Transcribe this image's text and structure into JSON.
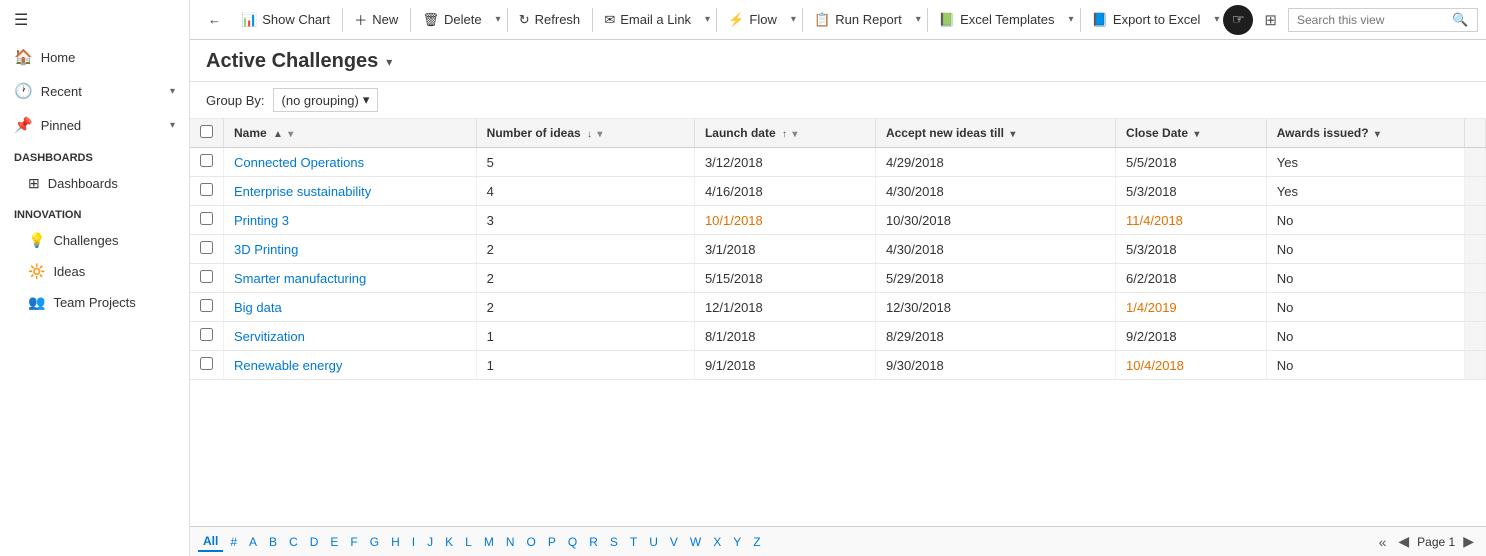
{
  "sidebar": {
    "hamburger": "☰",
    "nav": [
      {
        "id": "home",
        "icon": "🏠",
        "label": "Home",
        "hasChevron": false
      },
      {
        "id": "recent",
        "icon": "🕐",
        "label": "Recent",
        "hasChevron": true
      },
      {
        "id": "pinned",
        "icon": "📌",
        "label": "Pinned",
        "hasChevron": true
      }
    ],
    "sections": [
      {
        "label": "Dashboards",
        "children": [
          {
            "id": "dashboards",
            "icon": "⊞",
            "label": "Dashboards"
          }
        ]
      },
      {
        "label": "Innovation",
        "children": [
          {
            "id": "challenges",
            "icon": "💡",
            "label": "Challenges"
          },
          {
            "id": "ideas",
            "icon": "🔆",
            "label": "Ideas"
          },
          {
            "id": "team-projects",
            "icon": "👥",
            "label": "Team Projects"
          }
        ]
      }
    ]
  },
  "toolbar": {
    "back_icon": "←",
    "show_chart_label": "Show Chart",
    "new_label": "New",
    "delete_label": "Delete",
    "refresh_label": "Refresh",
    "email_link_label": "Email a Link",
    "flow_label": "Flow",
    "run_report_label": "Run Report",
    "excel_templates_label": "Excel Templates",
    "export_excel_label": "Export to Excel",
    "more_icon": "⋯",
    "search_placeholder": "Search this view",
    "search_icon": "🔍"
  },
  "view": {
    "title": "Active Challenges",
    "chevron": "▾",
    "group_by_label": "Group By:",
    "group_by_value": "(no grouping)",
    "group_by_chevron": "▾"
  },
  "columns": [
    {
      "id": "name",
      "label": "Name",
      "sort": "▲",
      "filter": "▾"
    },
    {
      "id": "ideas",
      "label": "Number of ideas",
      "sort": "↓",
      "filter": "▾"
    },
    {
      "id": "launch",
      "label": "Launch date",
      "sort": "↑",
      "filter": "▾"
    },
    {
      "id": "accept",
      "label": "Accept new ideas till",
      "sort": "▾",
      "filter": ""
    },
    {
      "id": "close",
      "label": "Close Date",
      "sort": "▾",
      "filter": ""
    },
    {
      "id": "awards",
      "label": "Awards issued?",
      "sort": "▾",
      "filter": ""
    }
  ],
  "rows": [
    {
      "name": "Connected Operations",
      "ideas": "5",
      "launch": "3/12/2018",
      "accept": "4/29/2018",
      "close": "5/5/2018",
      "awards": "Yes",
      "launchOrange": false,
      "closeOrange": false
    },
    {
      "name": "Enterprise sustainability",
      "ideas": "4",
      "launch": "4/16/2018",
      "accept": "4/30/2018",
      "close": "5/3/2018",
      "awards": "Yes",
      "launchOrange": false,
      "closeOrange": false
    },
    {
      "name": "Printing 3",
      "ideas": "3",
      "launch": "10/1/2018",
      "accept": "10/30/2018",
      "close": "11/4/2018",
      "awards": "No",
      "launchOrange": true,
      "closeOrange": true
    },
    {
      "name": "3D Printing",
      "ideas": "2",
      "launch": "3/1/2018",
      "accept": "4/30/2018",
      "close": "5/3/2018",
      "awards": "No",
      "launchOrange": false,
      "closeOrange": false
    },
    {
      "name": "Smarter manufacturing",
      "ideas": "2",
      "launch": "5/15/2018",
      "accept": "5/29/2018",
      "close": "6/2/2018",
      "awards": "No",
      "launchOrange": false,
      "closeOrange": false
    },
    {
      "name": "Big data",
      "ideas": "2",
      "launch": "12/1/2018",
      "accept": "12/30/2018",
      "close": "1/4/2019",
      "awards": "No",
      "launchOrange": false,
      "closeOrange": true
    },
    {
      "name": "Servitization",
      "ideas": "1",
      "launch": "8/1/2018",
      "accept": "8/29/2018",
      "close": "9/2/2018",
      "awards": "No",
      "launchOrange": false,
      "closeOrange": false
    },
    {
      "name": "Renewable energy",
      "ideas": "1",
      "launch": "9/1/2018",
      "accept": "9/30/2018",
      "close": "10/4/2018",
      "awards": "No",
      "launchOrange": false,
      "closeOrange": true
    }
  ],
  "pagination": {
    "alpha": [
      "All",
      "#",
      "A",
      "B",
      "C",
      "D",
      "E",
      "F",
      "G",
      "H",
      "I",
      "J",
      "K",
      "L",
      "M",
      "N",
      "O",
      "P",
      "Q",
      "R",
      "S",
      "T",
      "U",
      "V",
      "W",
      "X",
      "Y",
      "Z"
    ],
    "active_alpha": "All",
    "prev_icon": "◀",
    "prev_prev_icon": "«",
    "next_icon": "▶",
    "page_label": "Page 1"
  }
}
